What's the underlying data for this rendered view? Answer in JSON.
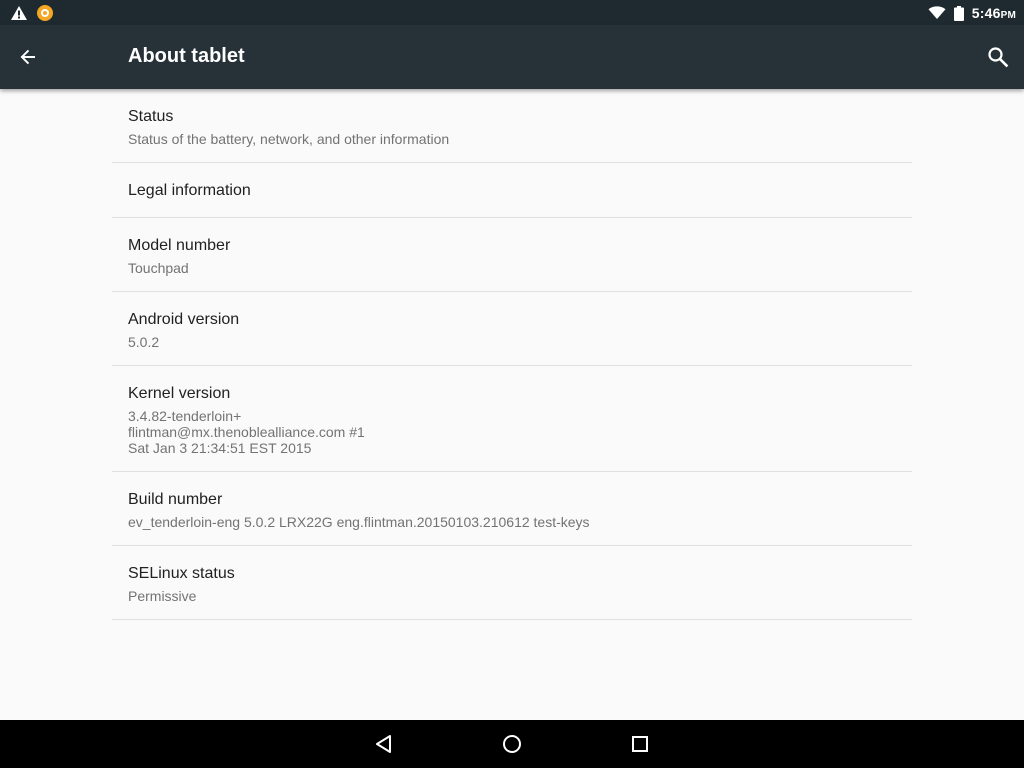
{
  "status_bar": {
    "time": "5:46",
    "ampm": "PM",
    "left_icons": [
      "warning-icon",
      "notification-icon"
    ],
    "right_icons": [
      "wifi-icon",
      "battery-icon"
    ]
  },
  "app_bar": {
    "title": "About tablet",
    "back_icon": "arrow-back-icon",
    "search_icon": "search-icon",
    "color": "#263238"
  },
  "items": [
    {
      "title": "Status",
      "subtitle": "Status of the battery, network, and other information"
    },
    {
      "title": "Legal information",
      "subtitle": ""
    },
    {
      "title": "Model number",
      "subtitle": "Touchpad"
    },
    {
      "title": "Android version",
      "subtitle": "5.0.2"
    },
    {
      "title": "Kernel version",
      "subtitle": "3.4.82-tenderloin+\nflintman@mx.thenoblealliance.com #1\nSat Jan 3 21:34:51 EST 2015"
    },
    {
      "title": "Build number",
      "subtitle": "ev_tenderloin-eng 5.0.2 LRX22G eng.flintman.20150103.210612 test-keys"
    },
    {
      "title": "SELinux status",
      "subtitle": "Permissive"
    }
  ],
  "nav_bar": {
    "buttons": [
      "back-triangle-icon",
      "home-circle-icon",
      "recents-square-icon"
    ]
  }
}
